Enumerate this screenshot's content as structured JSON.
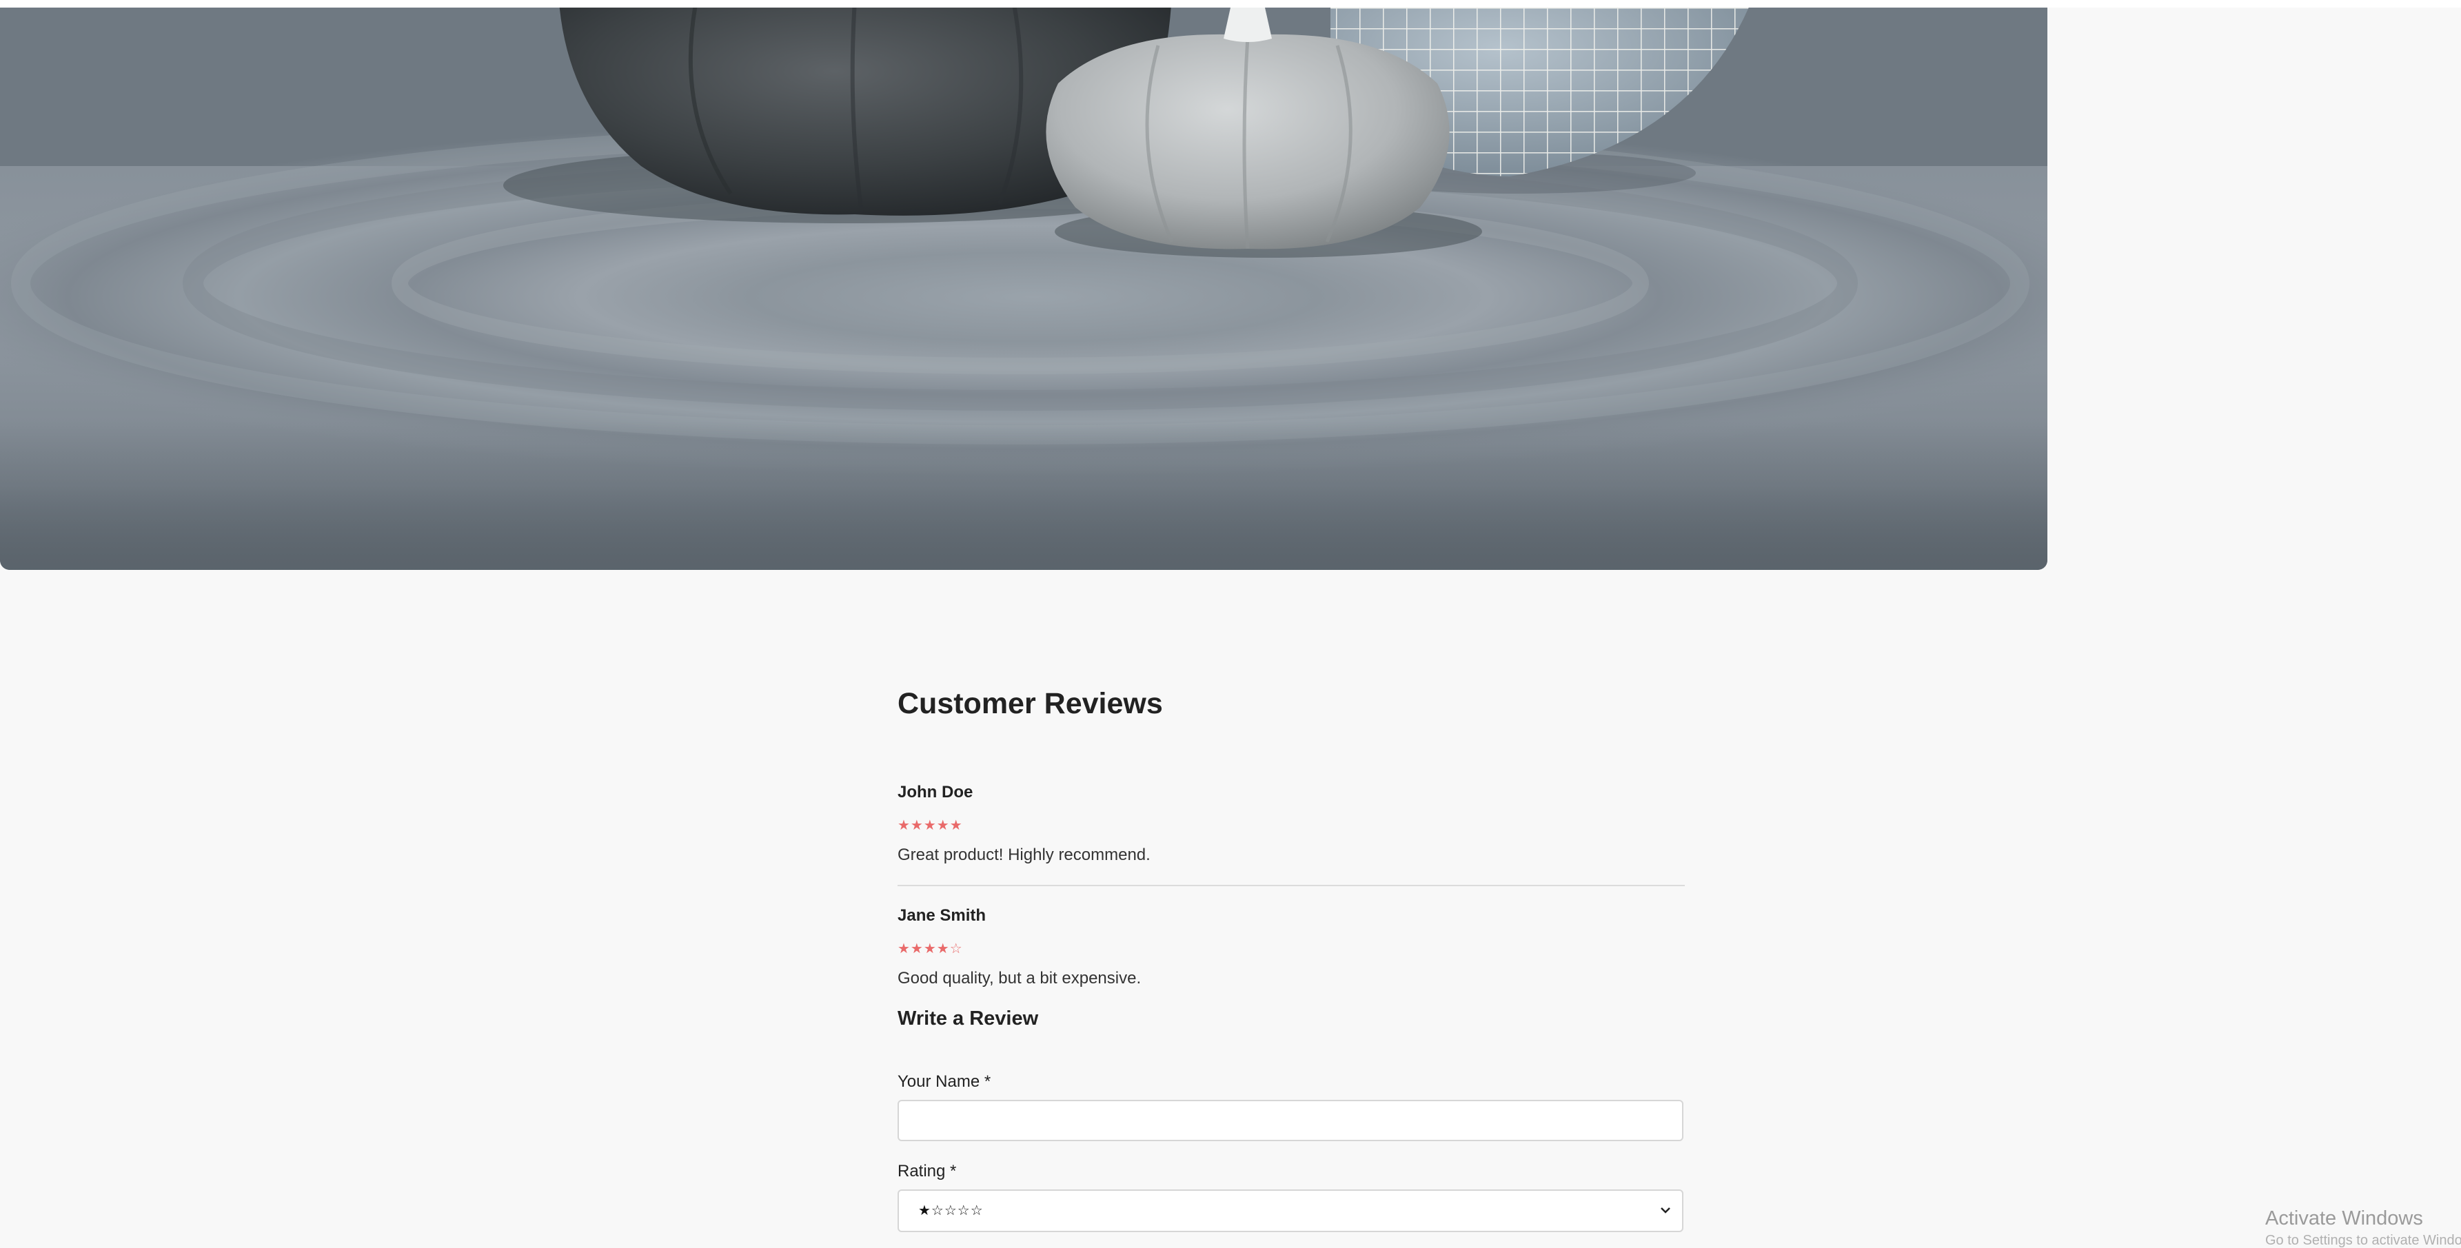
{
  "hero": {
    "image_subject": "pumpkins-and-wire-sphere-photo"
  },
  "reviews": {
    "heading": "Customer Reviews",
    "items": [
      {
        "name": "John Doe",
        "stars": "★★★★★",
        "rating": 5,
        "text": "Great product! Highly recommend."
      },
      {
        "name": "Jane Smith",
        "stars": "★★★★☆",
        "rating": 4,
        "text": "Good quality, but a bit expensive."
      }
    ],
    "star_color": "#e96a6a"
  },
  "form": {
    "title": "Write a Review",
    "name_label": "Your Name *",
    "name_value": "",
    "rating_label": "Rating *",
    "rating_selected": "★☆☆☆☆"
  },
  "os_watermark": {
    "title": "Activate Windows",
    "subtitle": "Go to Settings to activate Windows."
  }
}
